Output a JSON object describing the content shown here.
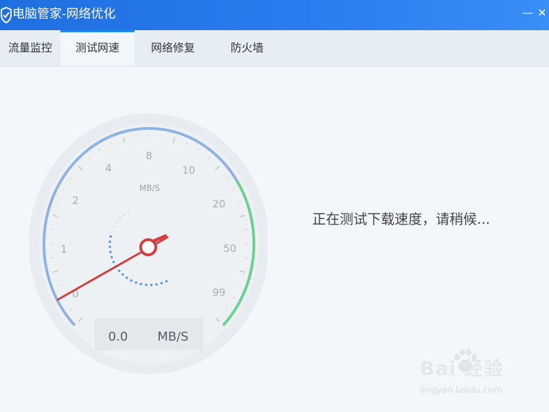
{
  "window": {
    "title": "电脑管家-网络优化",
    "app_icon": "shield-check-icon",
    "minimize_icon": "minimize-icon",
    "close_icon": "close-icon"
  },
  "tabs": [
    {
      "label": "流量监控",
      "active": false
    },
    {
      "label": "测试网速",
      "active": true
    },
    {
      "label": "网络修复",
      "active": false
    },
    {
      "label": "防火墙",
      "active": false
    }
  ],
  "gauge": {
    "unit_label": "MB/S",
    "scale_labels": [
      "0",
      "1",
      "2",
      "4",
      "8",
      "10",
      "20",
      "50",
      "99"
    ],
    "needle_value": "0.0",
    "readout_value": "0.0",
    "readout_unit": "MB/S",
    "colors": {
      "low_arc": "#8fb2e4",
      "high_arc": "#6cd08e",
      "needle": "#d33d3d",
      "dots": "#5b9be8"
    }
  },
  "status": {
    "text": "正在测试下载速度，请稍候..."
  },
  "watermark": {
    "brand": "Bai  经验",
    "url": "jingyan.baidu.com"
  }
}
